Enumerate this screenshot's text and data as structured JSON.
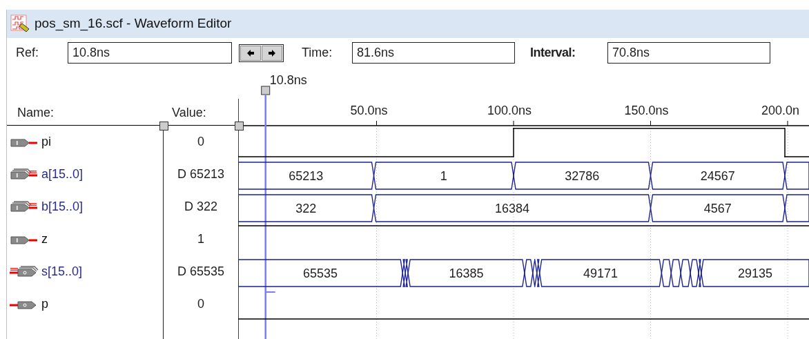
{
  "window": {
    "title": "pos_sm_16.scf - Waveform Editor"
  },
  "toolbar": {
    "ref": {
      "label": "Ref:",
      "value": "10.8ns"
    },
    "time": {
      "label": "Time:",
      "value": "81.6ns"
    },
    "interval": {
      "label": "Interval:",
      "value": "70.8ns"
    }
  },
  "cursor": {
    "label": "10.8ns"
  },
  "time_scale": [
    "50.0ns",
    "100.0ns",
    "150.0ns",
    "200.0n"
  ],
  "columns": {
    "name": "Name:",
    "value": "Value:"
  },
  "signals": [
    {
      "name": "pi",
      "value": "0",
      "kind": "input",
      "bus": false,
      "segments": [
        {
          "high": false
        },
        {
          "high": true
        },
        {
          "high": false
        }
      ]
    },
    {
      "name": "a[15..0]",
      "value": "D 65213",
      "kind": "input",
      "bus": true,
      "segments": [
        {
          "label": "65213"
        },
        {
          "label": "1"
        },
        {
          "label": "32786"
        },
        {
          "label": "24567"
        }
      ]
    },
    {
      "name": "b[15..0]",
      "value": "D 322",
      "kind": "input",
      "bus": true,
      "segments": [
        {
          "label": "322"
        },
        {
          "label": "16384"
        },
        {
          "label": "4567"
        }
      ]
    },
    {
      "name": "z",
      "value": "1",
      "kind": "input",
      "bus": false,
      "segments": [
        {
          "high": true
        }
      ]
    },
    {
      "name": "s[15..0]",
      "value": "D 65535",
      "kind": "output",
      "bus": true,
      "segments": [
        {
          "label": "65535"
        },
        {
          "label": "16385"
        },
        {
          "label": "49171"
        },
        {
          "label": "29135"
        }
      ]
    },
    {
      "name": "p",
      "value": "0",
      "kind": "output",
      "bus": false,
      "segments": [
        {
          "high": false
        }
      ]
    }
  ]
}
